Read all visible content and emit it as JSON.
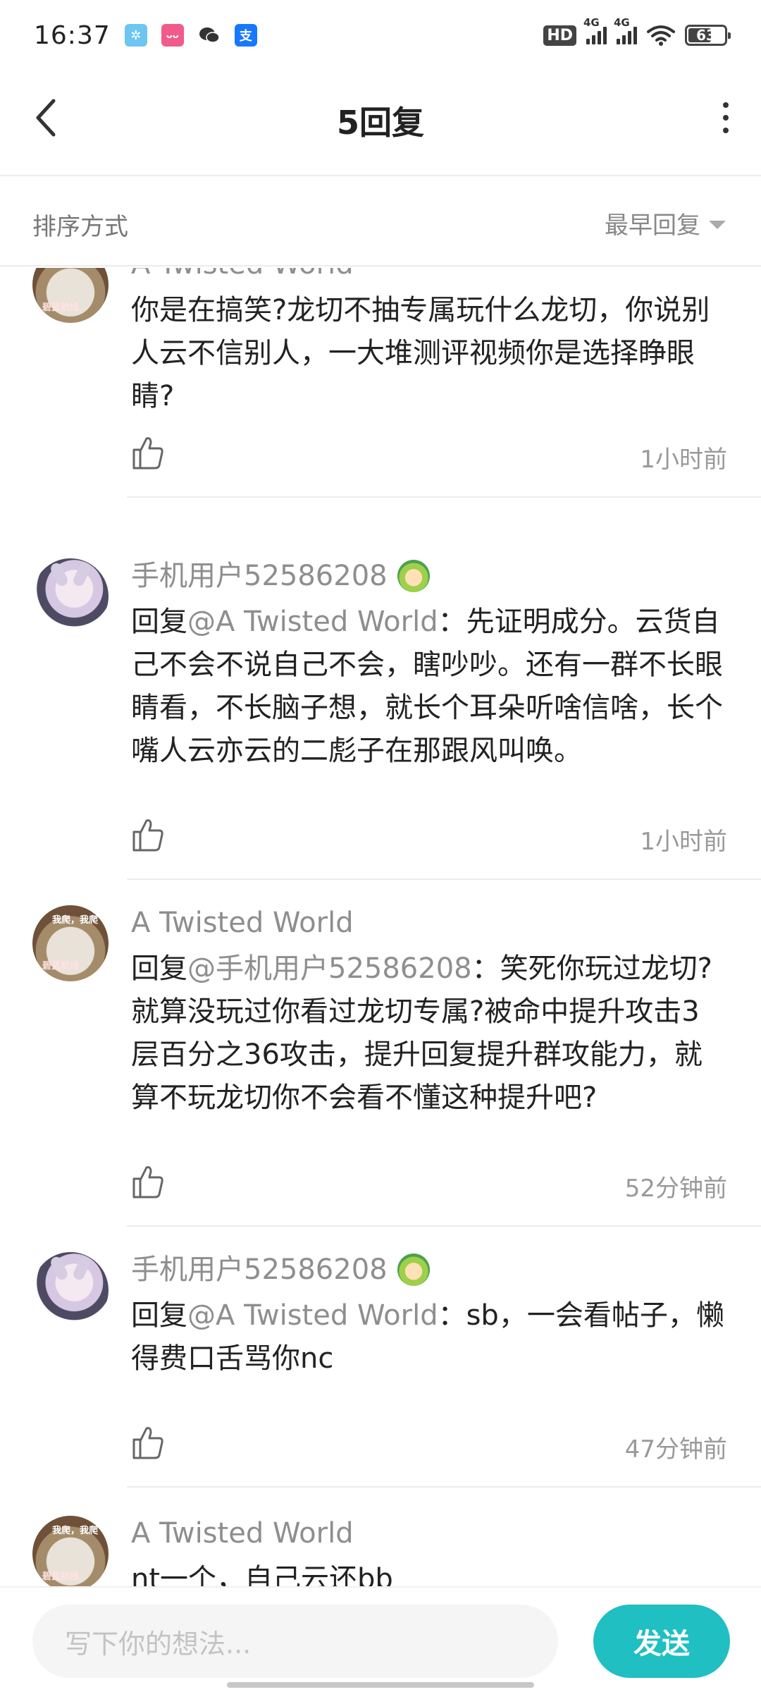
{
  "status_bar": {
    "time": "16:37",
    "notifications": [
      "pinwheel-app-icon",
      "bilibili-app-icon",
      "wechat-icon",
      "alipay-icon"
    ],
    "hd_label": "HD",
    "network_1": "4G",
    "network_2": "4G",
    "battery": "63"
  },
  "header": {
    "title": "5回复"
  },
  "sort": {
    "label": "排序方式",
    "selected": "最早回复"
  },
  "replies": [
    {
      "username": "A Twisted World",
      "avatar": "cat-avatar",
      "mention": "",
      "text": "你是在搞笑?龙切不抽专属玩什么龙切，你说别人云不信别人，一大堆测评视频你是选择睁眼睛?",
      "time": "1小时前"
    },
    {
      "username": "手机用户52586208",
      "avatar": "anime-girl-avatar",
      "badge": "level-badge-icon",
      "reply_prefix": "回复",
      "mention": "@A Twisted World",
      "text": "：先证明成分。云货自己不会不说自己不会，瞎吵吵。还有一群不长眼睛看，不长脑子想，就长个耳朵听啥信啥，长个嘴人云亦云的二彪子在那跟风叫唤。",
      "time": "1小时前"
    },
    {
      "username": "A Twisted World",
      "avatar": "cat-avatar",
      "reply_prefix": "回复",
      "mention": "@手机用户52586208",
      "text": "：笑死你玩过龙切?就算没玩过你看过龙切专属?被命中提升攻击3层百分之36攻击，提升回复提升群攻能力，就算不玩龙切你不会看不懂这种提升吧?",
      "time": "52分钟前"
    },
    {
      "username": "手机用户52586208",
      "avatar": "anime-girl-avatar",
      "badge": "level-badge-icon",
      "reply_prefix": "回复",
      "mention": "@A Twisted World",
      "text": "：sb，一会看帖子，懒得费口舌骂你nc",
      "time": "47分钟前"
    },
    {
      "username": "A Twisted World",
      "avatar": "cat-avatar",
      "text": "nt一个，自己云还bb"
    }
  ],
  "avatar_text": {
    "cat_top": "我爬，我爬",
    "cat_bottom": "碧蓝航线"
  },
  "composer": {
    "placeholder": "写下你的想法...",
    "send_label": "发送"
  },
  "colors": {
    "accent": "#1fbfc2",
    "muted_text": "#8e8e8e",
    "divider": "#ececec"
  }
}
